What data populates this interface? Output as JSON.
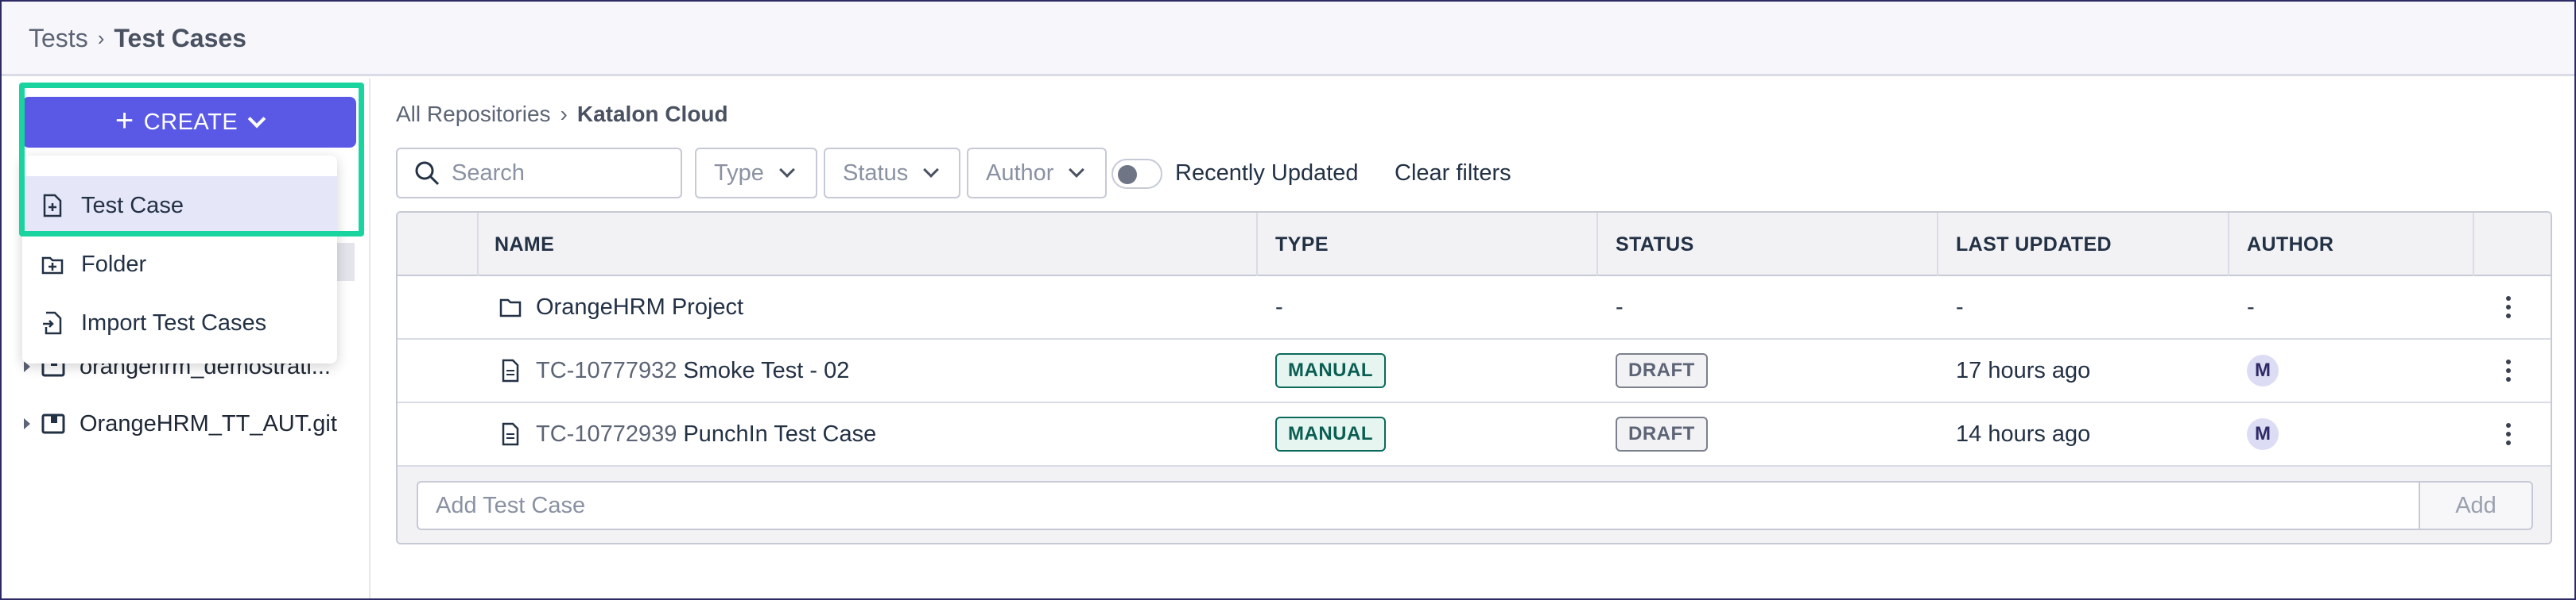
{
  "header": {
    "breadcrumb": [
      "Tests",
      "Test Cases"
    ]
  },
  "sidebar": {
    "create_label": "CREATE",
    "menu": [
      {
        "label": "Test Case",
        "icon": "file-plus-icon",
        "selected": true
      },
      {
        "label": "Folder",
        "icon": "folder-plus-icon",
        "selected": false
      },
      {
        "label": "Import Test Cases",
        "icon": "import-file-icon",
        "selected": false
      }
    ],
    "tree": [
      {
        "label": "orangehrm_demostrati...",
        "icon": "repo-icon"
      },
      {
        "label": "OrangeHRM_TT_AUT.git",
        "icon": "repo-icon"
      }
    ]
  },
  "main": {
    "breadcrumb": [
      "All Repositories",
      "Katalon Cloud"
    ],
    "search_placeholder": "Search",
    "filters": [
      "Type",
      "Status",
      "Author"
    ],
    "toggle_label": "Recently Updated",
    "clear_filters": "Clear filters",
    "table": {
      "columns": [
        "NAME",
        "TYPE",
        "STATUS",
        "LAST UPDATED",
        "AUTHOR"
      ],
      "rows": [
        {
          "icon": "folder-icon",
          "id": "",
          "name": "OrangeHRM Project",
          "type": "-",
          "status": "-",
          "updated": "-",
          "author": "-"
        },
        {
          "icon": "file-icon",
          "id": "TC-10777932",
          "name": "Smoke Test - 02",
          "type": "MANUAL",
          "status": "DRAFT",
          "updated": "17 hours ago",
          "author": "M"
        },
        {
          "icon": "file-icon",
          "id": "TC-10772939",
          "name": "PunchIn Test Case",
          "type": "MANUAL",
          "status": "DRAFT",
          "updated": "14 hours ago",
          "author": "M"
        }
      ]
    },
    "add_placeholder": "Add Test Case",
    "add_button": "Add"
  },
  "colors": {
    "accent": "#5959e6",
    "highlight": "#1ad4a0",
    "manual": "#0b6a5c"
  }
}
